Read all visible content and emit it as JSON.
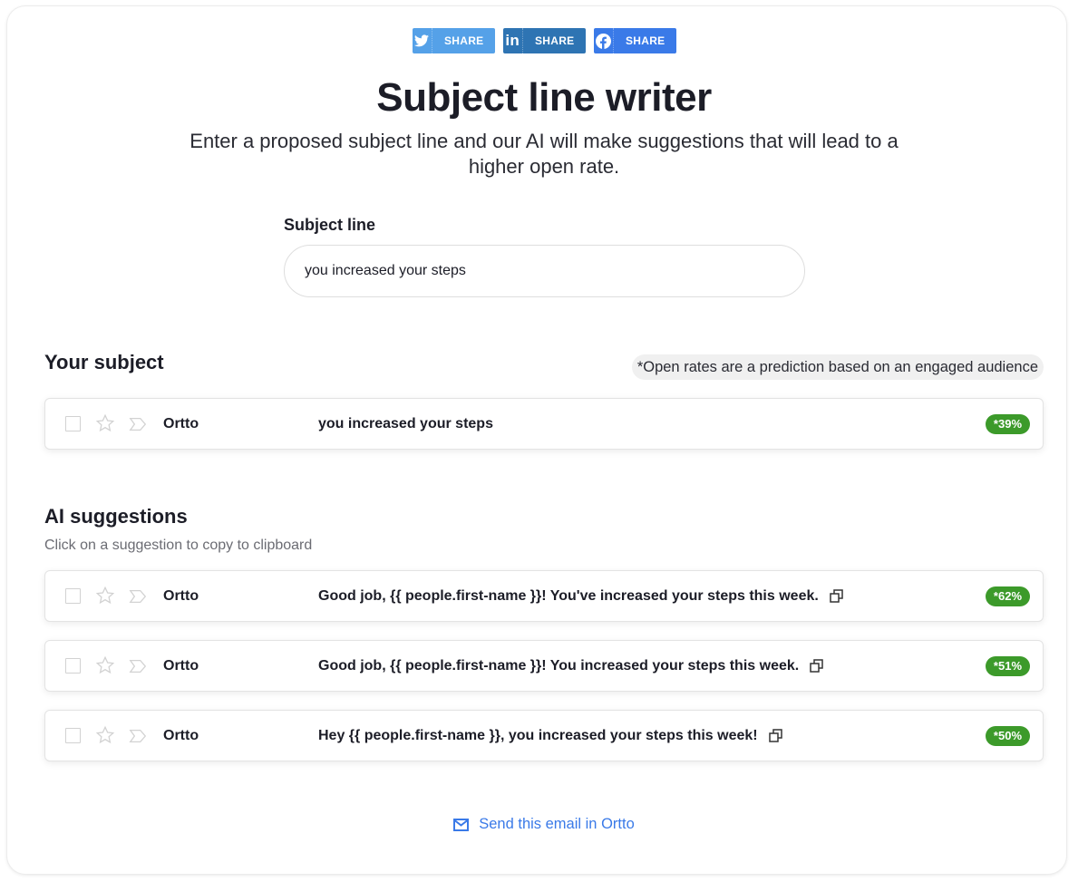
{
  "share": {
    "buttons": [
      {
        "network": "twitter",
        "icon": "twitter-icon",
        "label": "SHARE",
        "color": "#55a1e8"
      },
      {
        "network": "linkedin",
        "icon": "linkedin-icon",
        "label": "SHARE",
        "color": "#2e74b3"
      },
      {
        "network": "facebook",
        "icon": "facebook-icon",
        "label": "SHARE",
        "color": "#3a7ae8"
      }
    ]
  },
  "header": {
    "title": "Subject line writer",
    "subtitle": "Enter a proposed subject line and our AI will make suggestions that will lead to a higher open rate."
  },
  "form": {
    "label": "Subject line",
    "value": "you increased your steps",
    "placeholder": ""
  },
  "your_subject": {
    "title": "Your subject",
    "disclaimer": "*Open rates are a prediction based on an engaged audience",
    "row": {
      "sender": "Ortto",
      "subject": "you increased your steps",
      "rate": "*39%"
    }
  },
  "suggestions": {
    "title": "AI suggestions",
    "hint": "Click on a suggestion to copy to clipboard",
    "rows": [
      {
        "sender": "Ortto",
        "subject": "Good job, {{ people.first-name }}! You've increased your steps this week.",
        "rate": "*62%"
      },
      {
        "sender": "Ortto",
        "subject": "Good job, {{ people.first-name }}! You increased your steps this week.",
        "rate": "*51%"
      },
      {
        "sender": "Ortto",
        "subject": "Hey {{ people.first-name }}, you increased your steps this week!",
        "rate": "*50%"
      }
    ]
  },
  "footer": {
    "send_label": "Send this email in Ortto",
    "icon": "mail-icon"
  },
  "colors": {
    "accent": "#3a7ae8",
    "badge": "#3c9a2a",
    "text": "#1c1d27"
  }
}
